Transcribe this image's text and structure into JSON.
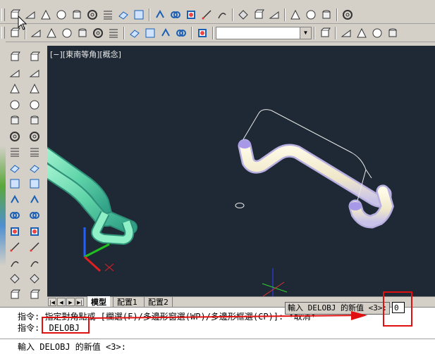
{
  "viewport": {
    "label": "[−][東南等角][概念]",
    "background": "#1f2936"
  },
  "layout_tabs": {
    "model": "模型",
    "layout1": "配置1",
    "layout2": "配置2"
  },
  "command": {
    "line1": "指令: 指定對角點或 [欄選(F)/多邊形窗選(WP)/多邊形框選(CP)]: *取消*",
    "line2_prefix": "指令:",
    "line2_value": "DELOBJ",
    "line3": "輸入 DELOBJ 的新值 <3>:"
  },
  "dynamic_input": {
    "prompt": "輸入 DELOBJ 的新值 <3>:",
    "value": "0"
  },
  "layer_select": {
    "value": ""
  },
  "toolbar_icons": {
    "row1": [
      "box-icon",
      "wedge-icon",
      "cone-icon",
      "sphere-icon",
      "cylinder-icon",
      "torus-icon",
      "pyramid-icon",
      "helix-icon",
      "planar-surface-icon",
      "extrude-icon",
      "presspull-icon",
      "sweep-icon",
      "revolve-icon",
      "loft-icon",
      "union-icon",
      "subtract-icon",
      "intersect-icon",
      "3d-move-icon",
      "3d-rotate-icon",
      "3d-align-icon",
      "union-icon-2"
    ],
    "row2": [
      "ucs-icon",
      "view-top-icon",
      "view-bottom-icon",
      "view-left-icon",
      "view-right-icon",
      "view-front-icon",
      "view-back-icon",
      "view-sw-icon",
      "view-se-icon",
      "view-ne-icon",
      "view-nw-icon",
      "camera-icon",
      "named-views-icon",
      "2d-wireframe-icon",
      "3d-hidden-icon",
      "realistic-icon",
      "conceptual-icon"
    ],
    "left1": [
      "line-icon",
      "construction-line-icon",
      "polyline-icon",
      "polygon-icon",
      "rectangle-icon",
      "arc-icon",
      "circle-icon",
      "revision-cloud-icon",
      "spline-icon",
      "ellipse-icon",
      "ellipse-arc-icon",
      "insert-block-icon",
      "make-block-icon",
      "point-icon",
      "hatch-icon",
      "gradient-icon",
      "region-icon",
      "table-icon"
    ],
    "left2": [
      "erase-icon",
      "copy-icon",
      "mirror-icon",
      "offset-icon",
      "array-icon",
      "move-icon",
      "rotate-icon",
      "scale-icon",
      "stretch-icon",
      "trim-icon",
      "extend-icon",
      "break-at-point-icon",
      "break-icon",
      "join-icon",
      "chamfer-icon",
      "fillet-icon",
      "explode-icon"
    ]
  },
  "colors": {
    "pipe_green": "#6fe0b0",
    "pipe_cream": "#f4efd8",
    "pipe_lavender": "#a898e8",
    "highlight_red": "#e01010"
  }
}
